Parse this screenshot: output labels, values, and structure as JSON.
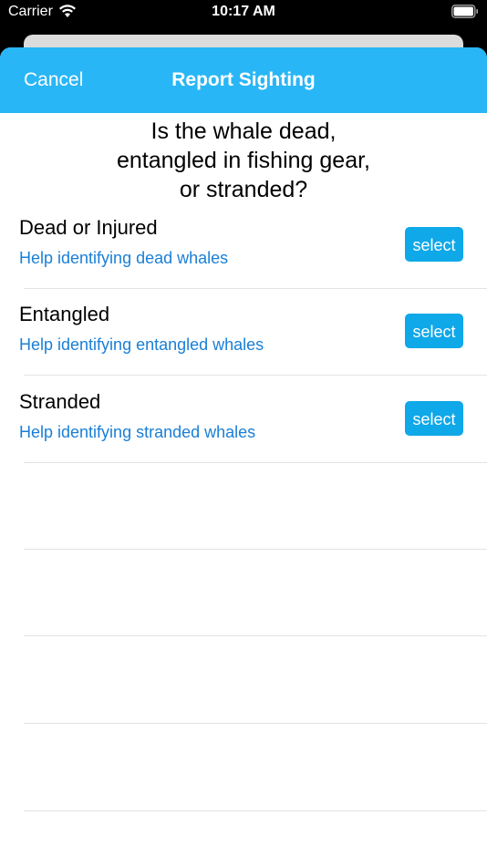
{
  "status_bar": {
    "carrier": "Carrier",
    "time": "10:17 AM"
  },
  "nav": {
    "cancel_label": "Cancel",
    "title": "Report Sighting"
  },
  "question": {
    "line1": "Is the whale dead,",
    "line2": "entangled in fishing gear,",
    "line3": "or stranded?"
  },
  "options": [
    {
      "title": "Dead or Injured",
      "help": "Help identifying dead whales",
      "button": "select"
    },
    {
      "title": "Entangled",
      "help": "Help identifying entangled whales",
      "button": "select"
    },
    {
      "title": "Stranded",
      "help": "Help identifying stranded whales",
      "button": "select"
    }
  ],
  "colors": {
    "nav_background": "#29b6f6",
    "select_button": "#0fa8e8",
    "link": "#1a7fd6"
  },
  "icons": [
    "wifi-icon",
    "battery-icon"
  ]
}
